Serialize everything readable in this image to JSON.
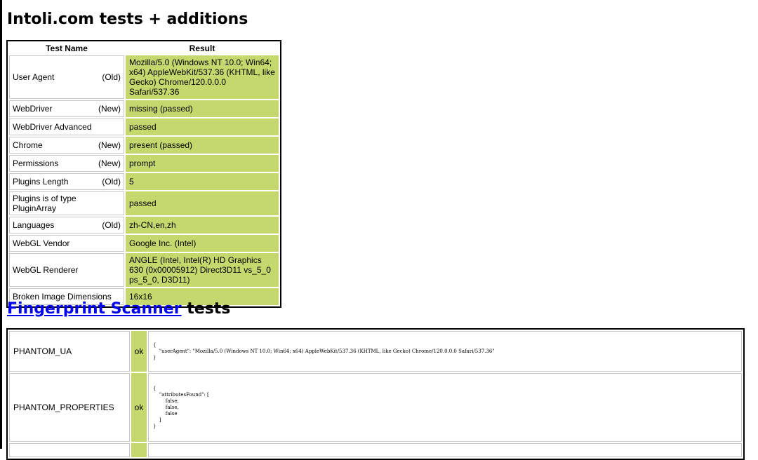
{
  "section1": {
    "title": "Intoli.com tests + additions",
    "headers": {
      "name": "Test Name",
      "result": "Result"
    },
    "rows": [
      {
        "name": "User Agent",
        "tag": "(Old)",
        "result": "Mozilla/5.0 (Windows NT 10.0; Win64; x64) AppleWebKit/537.36 (KHTML, like Gecko) Chrome/120.0.0.0 Safari/537.36"
      },
      {
        "name": "WebDriver",
        "tag": "(New)",
        "result": "missing (passed)"
      },
      {
        "name": "WebDriver Advanced",
        "tag": "",
        "result": "passed"
      },
      {
        "name": "Chrome",
        "tag": "(New)",
        "result": "present (passed)"
      },
      {
        "name": "Permissions",
        "tag": "(New)",
        "result": "prompt"
      },
      {
        "name": "Plugins Length",
        "tag": "(Old)",
        "result": "5"
      },
      {
        "name": "Plugins is of type PluginArray",
        "tag": "",
        "result": "passed"
      },
      {
        "name": "Languages",
        "tag": "(Old)",
        "result": "zh-CN,en,zh"
      },
      {
        "name": "WebGL Vendor",
        "tag": "",
        "result": "Google Inc. (Intel)"
      },
      {
        "name": "WebGL Renderer",
        "tag": "",
        "result": "ANGLE (Intel, Intel(R) HD Graphics 630 (0x00005912) Direct3D11 vs_5_0 ps_5_0, D3D11)"
      },
      {
        "name": "Broken Image Dimensions",
        "tag": "",
        "result": "16x16"
      }
    ]
  },
  "section2": {
    "title_link": "Fingerprint Scanner",
    "title_suffix": " tests",
    "rows": [
      {
        "name": "PHANTOM_UA",
        "status": "ok",
        "data": "{\n    \"userAgent\": \"Mozilla/5.0 (Windows NT 10.0; Win64; x64) AppleWebKit/537.36 (KHTML, like Gecko) Chrome/120.0.0.0 Safari/537.36\"\n}"
      },
      {
        "name": "PHANTOM_PROPERTIES",
        "status": "ok",
        "data": "{\n    \"attributesFound\": [\n        false,\n        false,\n        false\n    ]\n}"
      },
      {
        "name": "",
        "status": "",
        "data": ""
      }
    ]
  },
  "colors": {
    "result_bg": "#c5d86d",
    "link": "#0000ee",
    "border": "#000000"
  }
}
